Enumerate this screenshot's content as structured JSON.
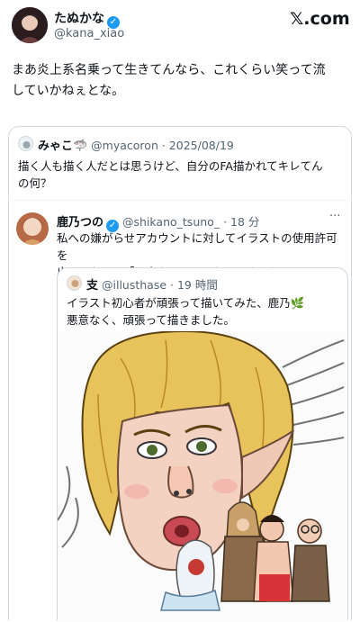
{
  "brand": {
    "logo_text": "𝕏.com"
  },
  "author": {
    "display_name": "たぬかな",
    "handle": "@kana_xiao",
    "verified": true
  },
  "tweet": {
    "text_line1": "まあ炎上系名乗って生きてんなら、これくらい笑って流",
    "text_line2": "していかねぇとな。"
  },
  "quote1": {
    "display_name": "みゃこ🦈",
    "handle": "@myacoron",
    "date": "· 2025/08/19",
    "text_line1": "描く人も描く人だとは思うけど、自分のFA描かれてキレてん",
    "text_line2": "の何？"
  },
  "quote2": {
    "display_name": "鹿乃つの",
    "handle": "@shikano_tsuno_",
    "time": "· 18 分",
    "more": "···",
    "text_line1": "私への嫌がらせアカウントに対してイラストの使用許可を",
    "text_line2": "出しておいて「悪意なく」ってなんですかね。"
  },
  "quote3": {
    "display_name": "支",
    "handle": "@illusthase",
    "time": "· 19 時間",
    "text_line1": "イラスト初心者が頑張って描いてみた、鹿乃🌿",
    "text_line2": "悪意なく、頑張って描きました。"
  },
  "colors": {
    "accent": "#1d9bf0",
    "text": "#0f1419",
    "muted": "#536471",
    "border": "#cfd9de",
    "hair": "#e8c25a"
  }
}
